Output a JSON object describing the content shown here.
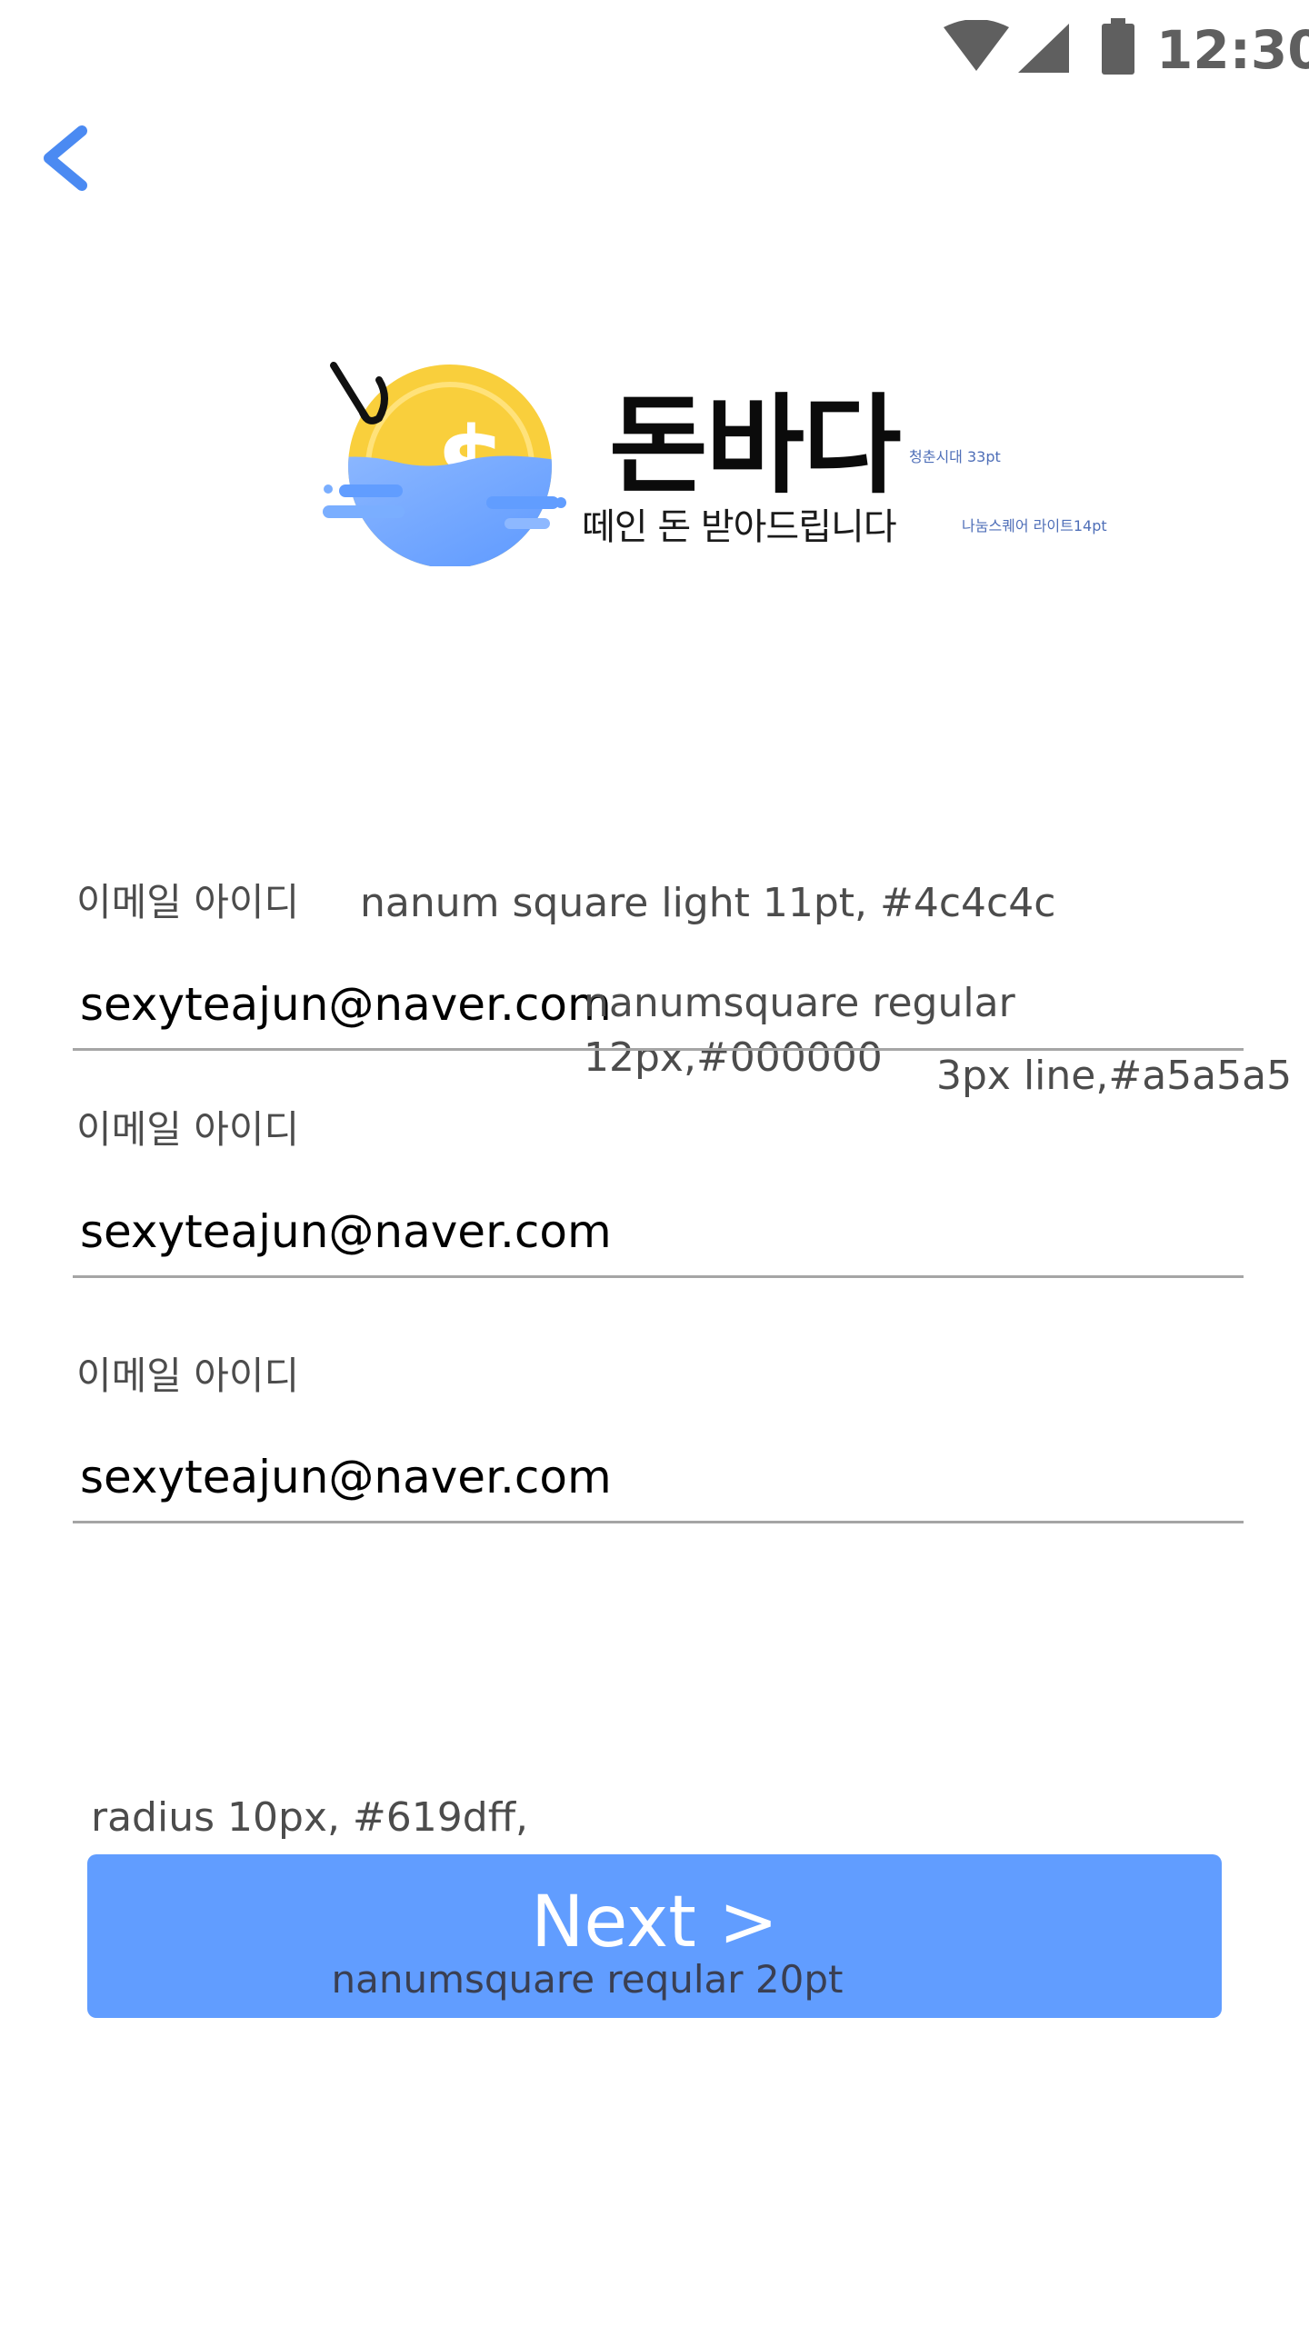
{
  "status_bar": {
    "time": "12:30",
    "icons": [
      "wifi-icon",
      "cell-signal-icon",
      "battery-icon"
    ]
  },
  "header": {
    "back_icon": "chevron-left-icon",
    "accent_color": "#4b8af2"
  },
  "logo": {
    "brand_name": "돈바다",
    "brand_note": "청춘시대 33pt",
    "tagline": "떼인 돈 받아드립니다",
    "tagline_note": "나눔스퀘어 라이트14pt",
    "colors": {
      "coin": "#f9cf3c",
      "water": "#619dff",
      "hook": "#111111"
    }
  },
  "form": {
    "label_spec_note": "nanum square light 11pt, #4c4c4c",
    "value_spec_note": "nanumsquare regular 12px,#000000",
    "line_spec_note": "3px line,#a5a5a5",
    "fields": [
      {
        "label": "이메일 아이디",
        "value": "sexyteajun@naver.com"
      },
      {
        "label": "이메일 아이디",
        "value": "sexyteajun@naver.com"
      },
      {
        "label": "이메일 아이디",
        "value": "sexyteajun@naver.com"
      }
    ],
    "line_color": "#a5a5a5",
    "label_color": "#4c4c4c"
  },
  "next_button": {
    "spec_note": "radius 10px, #619dff,",
    "label": "Next >",
    "font_note": "nanumsquare reqular 20pt",
    "color": "#619dff"
  }
}
